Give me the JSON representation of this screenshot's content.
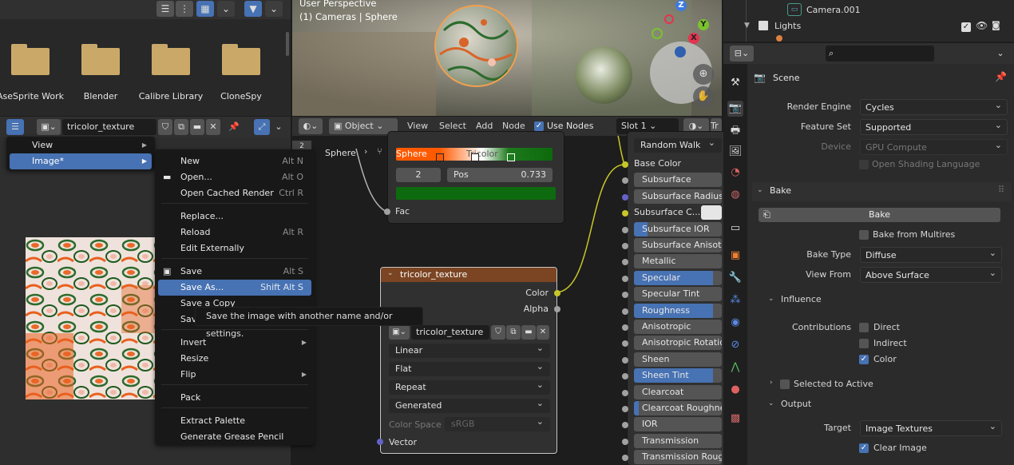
{
  "file_browser": {
    "folders": [
      "AseSprite Work",
      "Blender",
      "Calibre Library",
      "CloneSpy"
    ]
  },
  "image_editor": {
    "image_name": "tricolor_texture",
    "menu": {
      "items": [
        "View",
        "Image*"
      ]
    },
    "image_menu": [
      {
        "label": "New",
        "shortcut": "Alt N"
      },
      {
        "label": "Open...",
        "shortcut": "Alt O"
      },
      {
        "label": "Open Cached Render",
        "shortcut": "Ctrl R"
      },
      {
        "label": "Replace...",
        "shortcut": ""
      },
      {
        "label": "Reload",
        "shortcut": "Alt R"
      },
      {
        "label": "Edit Externally",
        "shortcut": ""
      },
      {
        "label": "Save",
        "shortcut": "Alt S"
      },
      {
        "label": "Save As...",
        "shortcut": "Shift Alt S"
      },
      {
        "label": "Save a Copy",
        "shortcut": ""
      },
      {
        "label": "Save",
        "shortcut": ""
      },
      {
        "label": "Invert",
        "shortcut": ""
      },
      {
        "label": "Resize",
        "shortcut": ""
      },
      {
        "label": "Flip",
        "shortcut": ""
      },
      {
        "label": "Pack",
        "shortcut": ""
      },
      {
        "label": "Extract Palette",
        "shortcut": ""
      },
      {
        "label": "Generate Grease Pencil",
        "shortcut": ""
      }
    ],
    "tooltip": "Save the image with another name and/or settings."
  },
  "viewport": {
    "title": "User Perspective",
    "subtitle": "(1) Cameras | Sphere",
    "axes": {
      "z": "Z",
      "y": "Y",
      "x": "X"
    }
  },
  "node_editor": {
    "header": {
      "mode": "Object",
      "menus": [
        "View",
        "Select",
        "Add",
        "Node"
      ],
      "use_nodes_label": "Use Nodes",
      "slot": "Slot 1"
    },
    "breadcrumb": [
      "Sphere"
    ],
    "color_ramp": {
      "stop_index": "2",
      "pos_label": "Pos",
      "pos_value": "0.733",
      "sphere_label": "Sphere",
      "tricolor_label": "Tricolor",
      "fac_label": "Fac"
    },
    "image_node": {
      "title": "tricolor_texture",
      "outputs": [
        "Color",
        "Alpha"
      ],
      "image_name": "tricolor_texture",
      "interpolation": "Linear",
      "projection": "Flat",
      "extension": "Repeat",
      "source": "Generated",
      "color_space_label": "Color Space",
      "color_space": "sRGB",
      "vector_label": "Vector"
    },
    "bsdf": {
      "subsurface_method": "Random Walk",
      "inputs": [
        {
          "label": "Base Color",
          "fill": 0
        },
        {
          "label": "Subsurface",
          "fill": 0
        },
        {
          "label": "Subsurface Radius",
          "fill": 0
        },
        {
          "label": "Subsurface C...",
          "fill": 0
        },
        {
          "label": "Subsurface IOR",
          "fill": 0.15
        },
        {
          "label": "Subsurface Anisotropy",
          "fill": 0
        },
        {
          "label": "Metallic",
          "fill": 0
        },
        {
          "label": "Specular",
          "fill": 0.9
        },
        {
          "label": "Specular Tint",
          "fill": 0
        },
        {
          "label": "Roughness",
          "fill": 0.9
        },
        {
          "label": "Anisotropic",
          "fill": 0
        },
        {
          "label": "Anisotropic Rotation",
          "fill": 0
        },
        {
          "label": "Sheen",
          "fill": 0
        },
        {
          "label": "Sheen Tint",
          "fill": 0.9
        },
        {
          "label": "Clearcoat",
          "fill": 0
        },
        {
          "label": "Clearcoat Roughness",
          "fill": 0.05
        },
        {
          "label": "IOR",
          "fill": 0
        },
        {
          "label": "Transmission",
          "fill": 0
        },
        {
          "label": "Transmission Roughness",
          "fill": 0
        }
      ]
    }
  },
  "outliner": {
    "items": [
      "Camera.001",
      "Lights"
    ]
  },
  "properties": {
    "context": "Scene",
    "render_engine_label": "Render Engine",
    "render_engine": "Cycles",
    "feature_set_label": "Feature Set",
    "feature_set": "Supported",
    "device_label": "Device",
    "device": "GPU Compute",
    "osl_label": "Open Shading Language",
    "bake_panel": "Bake",
    "bake_button": "Bake",
    "bake_from_multires": "Bake from Multires",
    "bake_type_label": "Bake Type",
    "bake_type": "Diffuse",
    "view_from_label": "View From",
    "view_from": "Above Surface",
    "influence_panel": "Influence",
    "contributions_label": "Contributions",
    "direct": "Direct",
    "indirect": "Indirect",
    "color": "Color",
    "selected_to_active": "Selected to Active",
    "output_panel": "Output",
    "target_label": "Target",
    "target": "Image Textures",
    "clear_image": "Clear Image"
  }
}
